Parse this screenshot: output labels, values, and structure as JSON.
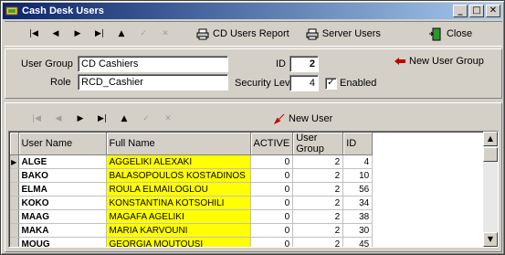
{
  "window": {
    "title": "Cash Desk Users"
  },
  "toolbar": {
    "nav": [
      "|◀",
      "◀",
      "▶",
      "▶|",
      "▲",
      "✓",
      "✕"
    ],
    "cd_users_report": "CD Users Report",
    "server_users": "Server Users",
    "close": "Close"
  },
  "form": {
    "user_group_label": "User Group",
    "user_group_value": "CD Cashiers",
    "role_label": "Role",
    "role_value": "RCD_Cashier",
    "id_label": "ID",
    "id_value": "2",
    "security_level_label": "Security Level",
    "security_level_value": "4",
    "enabled_label": "Enabled",
    "enabled_checked": true,
    "new_user_group": "New User Group"
  },
  "grid_toolbar": {
    "new_user": "New User"
  },
  "table": {
    "columns": [
      "User Name",
      "Full Name",
      "ACTIVE",
      "User Group",
      "ID"
    ],
    "rows": [
      {
        "user": "ALGE",
        "full": "AGGELIKI ALEXAKI",
        "active": "0",
        "group": "2",
        "id": "4"
      },
      {
        "user": "BAKO",
        "full": "BALASOPOULOS KOSTADINOS",
        "active": "0",
        "group": "2",
        "id": "10"
      },
      {
        "user": "ELMA",
        "full": "ROULA ELMAILOGLOU",
        "active": "0",
        "group": "2",
        "id": "56"
      },
      {
        "user": "KOKO",
        "full": "KONSTANTINA KOTSOHILI",
        "active": "0",
        "group": "2",
        "id": "34"
      },
      {
        "user": "MAAG",
        "full": "MAGAFA AGELIKI",
        "active": "0",
        "group": "2",
        "id": "38"
      },
      {
        "user": "MAKA",
        "full": "MARIA KARVOUNI",
        "active": "0",
        "group": "2",
        "id": "30"
      },
      {
        "user": "MOUG",
        "full": "GEORGIA MOUTOUSI",
        "active": "0",
        "group": "2",
        "id": "45"
      }
    ]
  },
  "colors": {
    "title_start": "#0a246a",
    "title_end": "#a6caf0",
    "highlight": "#ffff00",
    "face": "#d4d0c8"
  }
}
